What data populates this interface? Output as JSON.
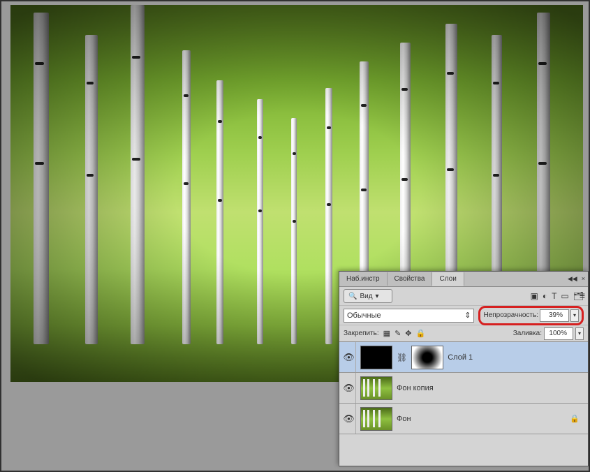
{
  "tabs": {
    "to_instr": "Наб.инстр",
    "properties": "Свойства",
    "layers": "Слои"
  },
  "filter": {
    "kind_label": "Вид"
  },
  "blend": {
    "mode": "Обычные",
    "opacity_label": "Непрозрачность:",
    "opacity_value": "39%"
  },
  "lock": {
    "label": "Закрепить:",
    "fill_label": "Заливка:",
    "fill_value": "100%"
  },
  "layers": [
    {
      "name": "Слой 1",
      "visible": true,
      "selected": true,
      "has_mask": true,
      "locked": false,
      "thumb": "black"
    },
    {
      "name": "Фон копия",
      "visible": true,
      "selected": false,
      "has_mask": false,
      "locked": false,
      "thumb": "forest"
    },
    {
      "name": "Фон",
      "visible": true,
      "selected": false,
      "has_mask": false,
      "locked": true,
      "thumb": "forest"
    }
  ],
  "icons": {
    "search": "🔍",
    "image_filter": "▣",
    "adjust_filter": "◐",
    "type_filter": "T",
    "shape_filter": "▭",
    "smart_filter": "🗂",
    "eye": "👁",
    "link": "⛓",
    "lock_trans": "▦",
    "brush": "✎",
    "move": "✥",
    "lock_all": "🔒",
    "chevron": "▾",
    "menu": "≡"
  }
}
